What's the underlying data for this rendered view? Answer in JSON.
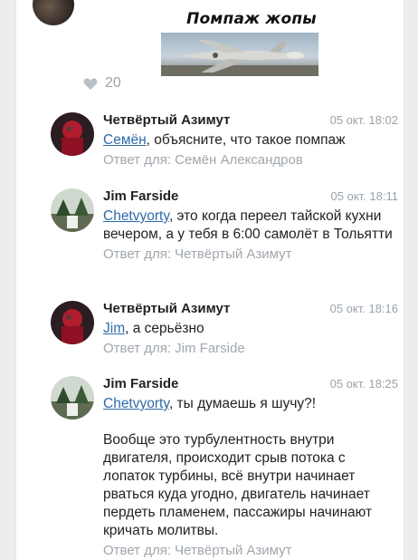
{
  "post": {
    "media_caption": "Помпаж жопы",
    "likes": "20"
  },
  "comments": [
    {
      "author": "Четвёртый Азимут",
      "date": "05 окт. 18:02",
      "mention": "Семён",
      "text": ", объясните, что такое помпаж",
      "reply_to": "Ответ для: Семён Александров"
    },
    {
      "author": "Jim Farside",
      "date": "05 окт. 18:11",
      "mention": "Chetvyorty",
      "text": ", это когда переел тайской кухни вечером, а у тебя в 6:00 самолёт в Тольятти",
      "reply_to": "Ответ для: Четвёртый Азимут"
    },
    {
      "author": "Четвёртый Азимут",
      "date": "05 окт. 18:16",
      "mention": "Jim",
      "text": ", а серьёзно",
      "reply_to": "Ответ для: Jim Farside"
    },
    {
      "author": "Jim Farside",
      "date": "05 окт. 18:25",
      "mention": "Chetvyorty",
      "text": ", ты думаешь я шучу?!",
      "paragraph": "Вообще это турбулентность внутри двигателя, происходит срыв потока с лопаток турбины, всё внутри начинает рваться куда угодно, двигатель начинает пердеть пламенем, пассажиры начинают кричать молитвы.",
      "reply_to": "Ответ для: Четвёртый Азимут"
    }
  ]
}
